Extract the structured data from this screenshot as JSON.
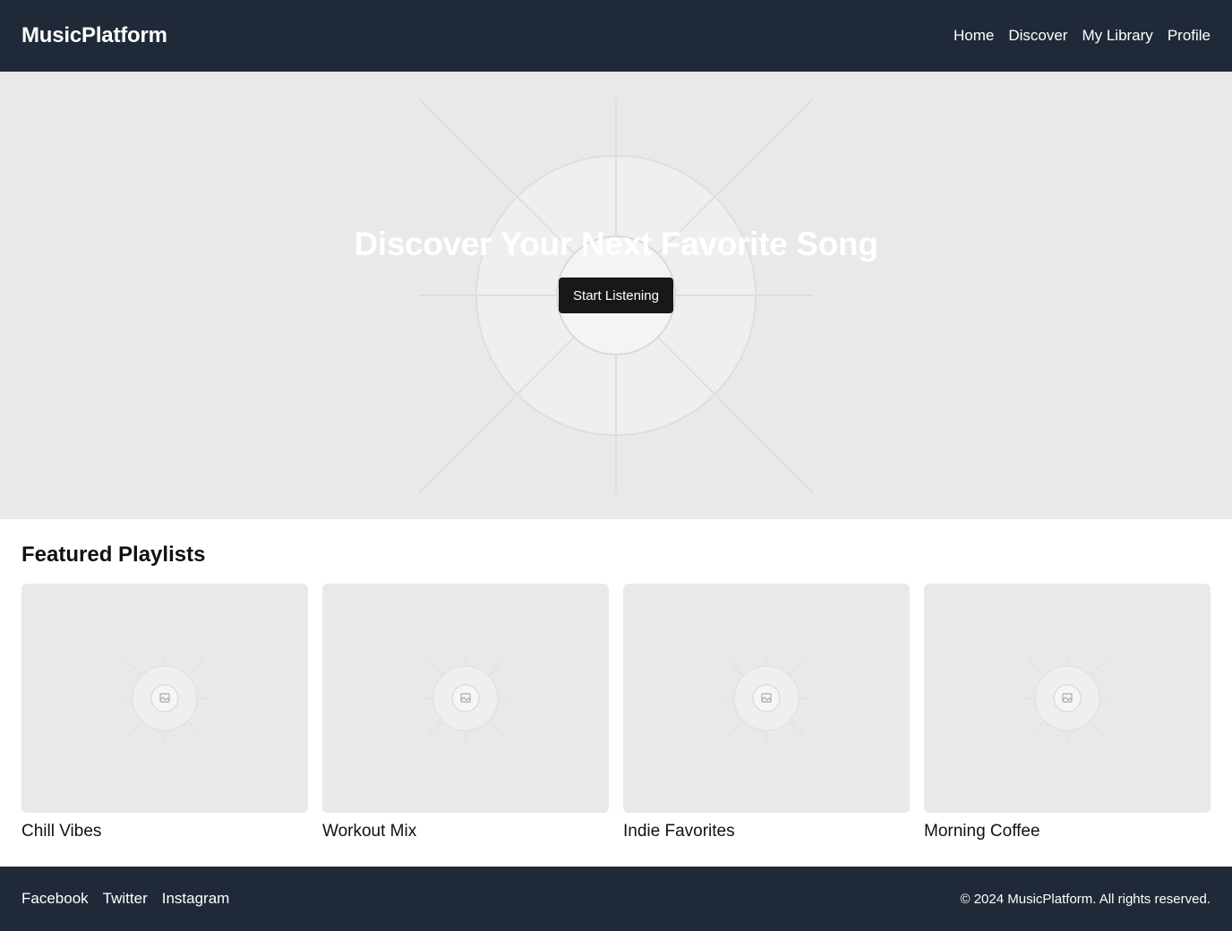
{
  "header": {
    "logo": "MusicPlatform",
    "nav": [
      "Home",
      "Discover",
      "My Library",
      "Profile"
    ]
  },
  "hero": {
    "title": "Discover Your Next Favorite Song",
    "button": "Start Listening",
    "image_icon": "image-placeholder-icon"
  },
  "featured": {
    "title": "Featured Playlists",
    "playlists": [
      {
        "title": "Chill Vibes"
      },
      {
        "title": "Workout Mix"
      },
      {
        "title": "Indie Favorites"
      },
      {
        "title": "Morning Coffee"
      }
    ]
  },
  "footer": {
    "social": [
      "Facebook",
      "Twitter",
      "Instagram"
    ],
    "copyright": "© 2024 MusicPlatform. All rights reserved."
  },
  "colors": {
    "header_bg": "#1f2937",
    "placeholder_bg": "#e9e9e9",
    "button_bg": "#18181b"
  }
}
